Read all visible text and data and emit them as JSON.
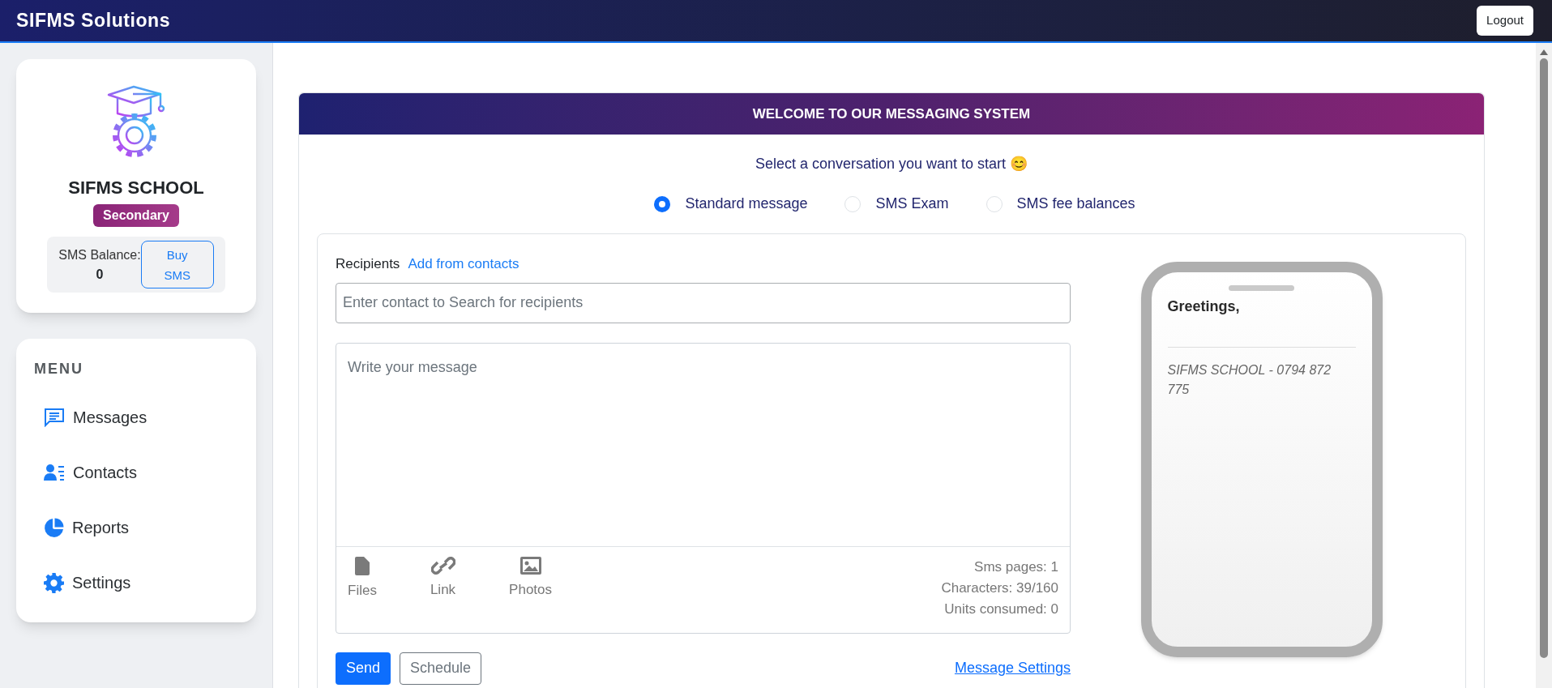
{
  "topbar": {
    "title": "SIFMS Solutions",
    "logout": "Logout"
  },
  "school_card": {
    "name": "SIFMS SCHOOL",
    "badge": "Secondary",
    "balance_label": "SMS Balance:",
    "balance_value": "0",
    "buy_button": "Buy SMS"
  },
  "menu": {
    "heading": "MENU",
    "items": [
      {
        "label": "Messages",
        "kind": "messages"
      },
      {
        "label": "Contacts",
        "kind": "contacts"
      },
      {
        "label": "Reports",
        "kind": "reports"
      },
      {
        "label": "Settings",
        "kind": "settings"
      }
    ]
  },
  "panel": {
    "title": "WELCOME TO OUR MESSAGING SYSTEM",
    "prompt": "Select a conversation you want to start 😊",
    "options": [
      {
        "label": "Standard message",
        "selected": true
      },
      {
        "label": "SMS Exam",
        "selected": false
      },
      {
        "label": "SMS fee balances",
        "selected": false
      }
    ]
  },
  "composer": {
    "recipients_label": "Recipients",
    "add_link": "Add from contacts",
    "search_placeholder": "Enter contact to Search for recipients",
    "message_placeholder": "Write your message",
    "attachments": [
      {
        "label": "Files",
        "kind": "file"
      },
      {
        "label": "Link",
        "kind": "link"
      },
      {
        "label": "Photos",
        "kind": "photo"
      }
    ],
    "stats": [
      "Sms pages: 1",
      "Characters: 39/160",
      "Units consumed: 0"
    ],
    "send": "Send",
    "schedule": "Schedule",
    "settings_link": "Message Settings"
  },
  "preview": {
    "greeting": "Greetings,",
    "signature": "SIFMS SCHOOL - 0794 872 775"
  }
}
